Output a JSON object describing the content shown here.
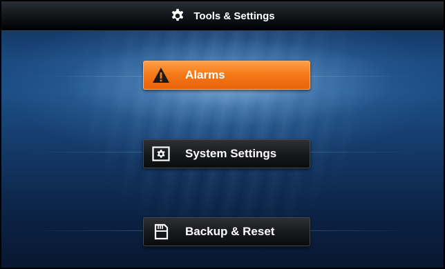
{
  "header": {
    "title": "Tools & Settings",
    "icon": "gear-icon"
  },
  "menu": [
    {
      "label": "Alarms",
      "icon": "warning-icon",
      "state": "selected"
    },
    {
      "label": "System Settings",
      "icon": "settings-screen-icon",
      "state": "normal"
    },
    {
      "label": "Backup & Reset",
      "icon": "sd-card-icon",
      "state": "normal"
    }
  ],
  "colors": {
    "accent": "#f57a18",
    "button_dark": "#16181b",
    "background": "#1d4f86"
  }
}
